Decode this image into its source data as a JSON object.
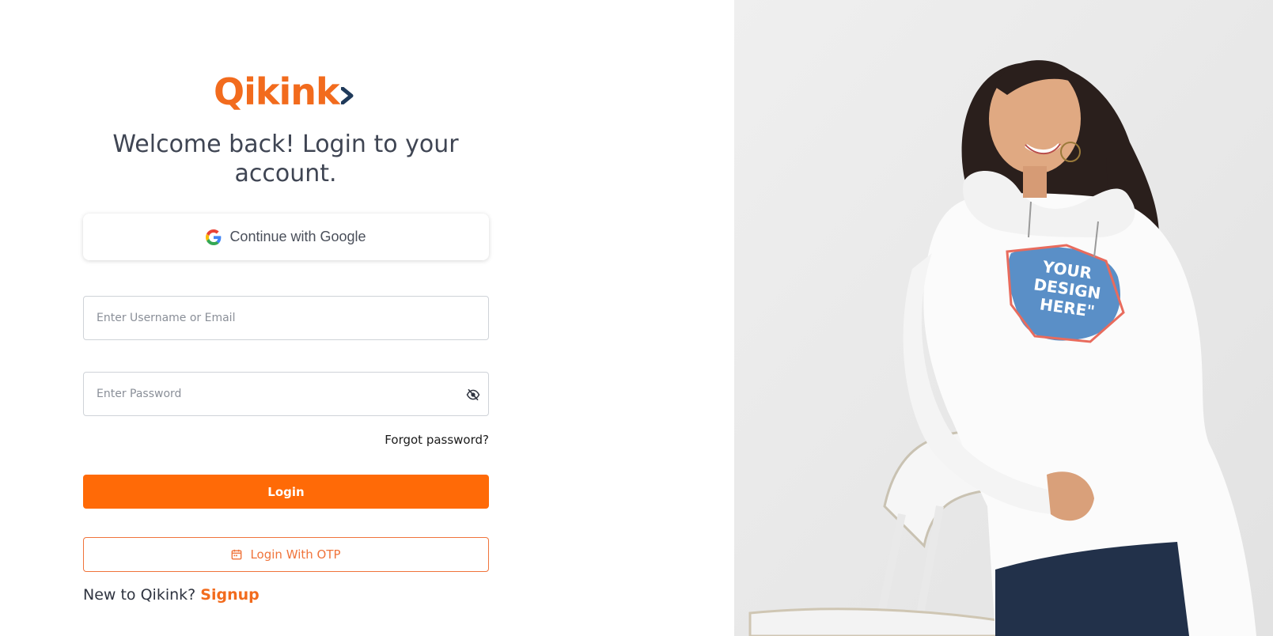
{
  "brand": {
    "name": "Qikink",
    "color": "#f26b1d",
    "accent": "#1f3a5a"
  },
  "heading": "Welcome back! Login to your account.",
  "google": {
    "label": "Continue with Google",
    "icon": "google-icon"
  },
  "username": {
    "placeholder": "Enter Username or Email",
    "value": ""
  },
  "password": {
    "placeholder": "Enter Password",
    "value": "",
    "toggle_icon": "eye-off-icon"
  },
  "forgot_label": "Forgot password?",
  "login_label": "Login",
  "otp": {
    "label": "Login With OTP",
    "icon": "calendar-icon"
  },
  "signup": {
    "prompt": "New to Qikink?",
    "link_label": "Signup"
  },
  "hero": {
    "print_text": "YOUR DESIGN HERE\""
  },
  "colors": {
    "primary": "#ff6a07",
    "text": "#3f4553",
    "border": "#cfd3d8"
  }
}
